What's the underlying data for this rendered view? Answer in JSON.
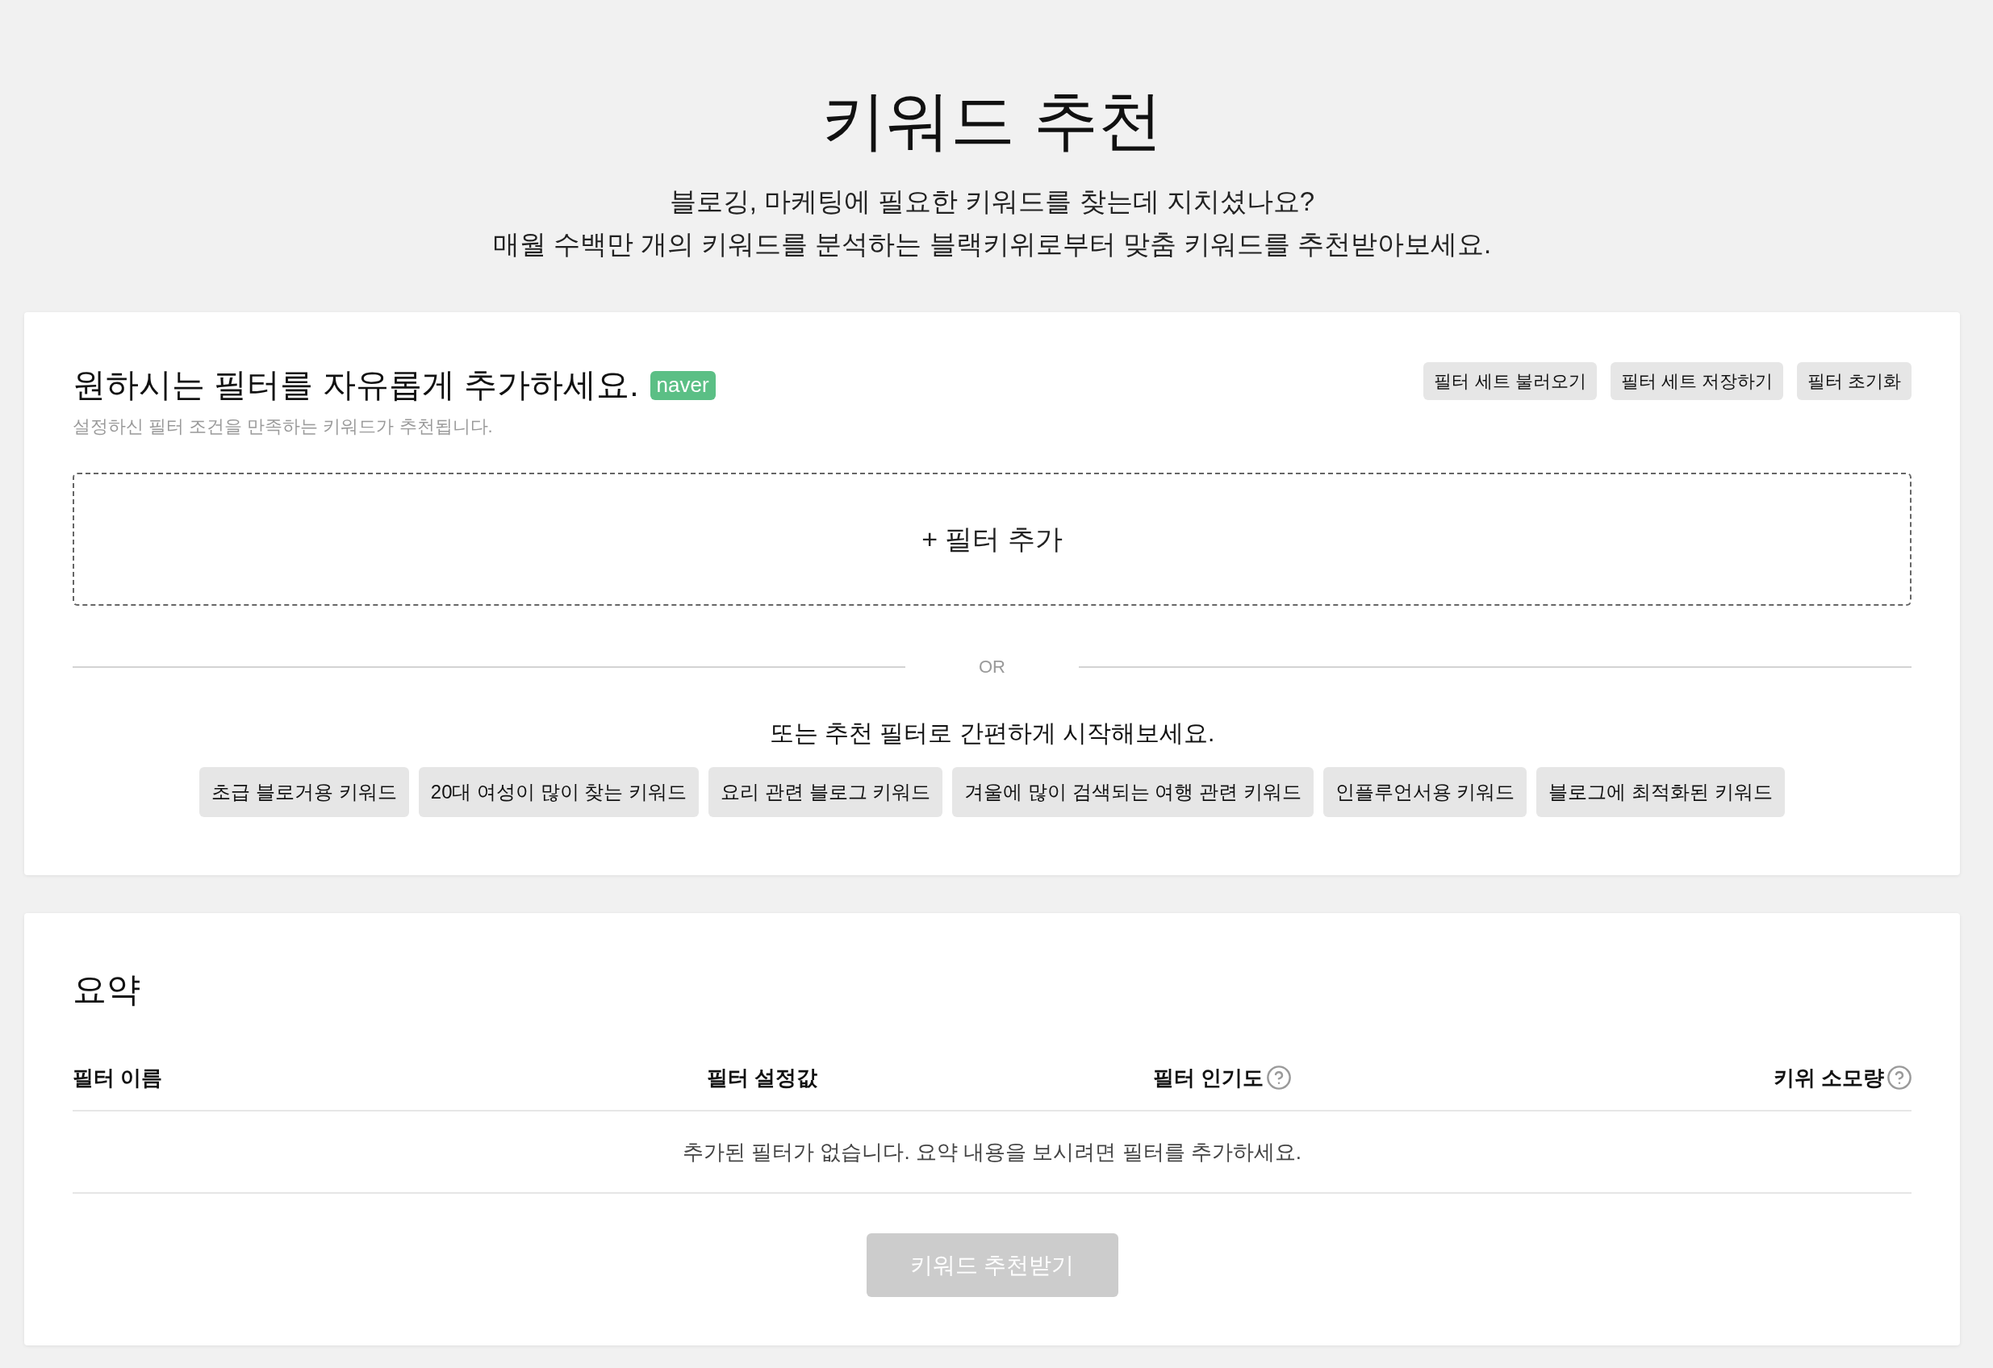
{
  "header": {
    "title": "키워드 추천",
    "subtitle_lines": [
      "블로깅, 마케팅에 필요한 키워드를 찾는데 지치셨나요?",
      "매월 수백만 개의 키워드를 분석하는 블랙키위로부터 맞춤 키워드를 추천받아보세요."
    ]
  },
  "filter_panel": {
    "heading": "원하시는 필터를 자유롭게 추가하세요.",
    "badge": "naver",
    "description": "설정하신 필터 조건을 만족하는 키워드가 추천됩니다.",
    "actions": [
      "필터 세트 불러오기",
      "필터 세트 저장하기",
      "필터 초기화"
    ],
    "add_filter": "+ 필터 추가",
    "divider": "OR",
    "suggestion_prompt": "또는 추천 필터로 간편하게 시작해보세요.",
    "suggestions": [
      "초급 블로거용 키워드",
      "20대 여성이 많이 찾는 키워드",
      "요리 관련 블로그 키워드",
      "겨울에 많이 검색되는 여행 관련 키워드",
      "인플루언서용 키워드",
      "블로그에 최적화된 키워드"
    ]
  },
  "summary": {
    "title": "요약",
    "columns": [
      {
        "label": "필터 이름",
        "help": false
      },
      {
        "label": "필터 설정값",
        "help": false
      },
      {
        "label": "필터 인기도",
        "help": true
      },
      {
        "label": "키위 소모량",
        "help": true
      }
    ],
    "empty_message": "추가된 필터가 없습니다. 요약 내용을 보시려면 필터를 추가하세요.",
    "submit": {
      "label": "키워드 추천받기",
      "disabled": true
    }
  }
}
